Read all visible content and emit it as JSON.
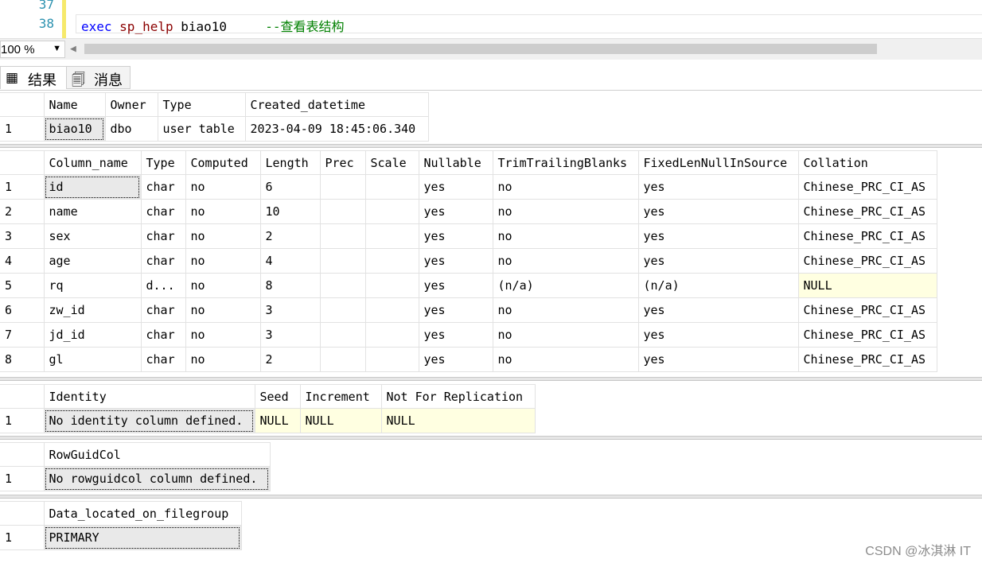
{
  "editor": {
    "line_numbers": [
      "37",
      "38"
    ],
    "code": {
      "keyword": "exec",
      "procedure": "sp_help",
      "argument": "biao10",
      "comment": "--查看表结构"
    }
  },
  "toolbar": {
    "zoom": "100 %"
  },
  "tabs": [
    {
      "label": "结果",
      "icon": "grid-icon",
      "active": true
    },
    {
      "label": "消息",
      "icon": "message-icon",
      "active": false
    }
  ],
  "results": {
    "table_info": {
      "headers": [
        "Name",
        "Owner",
        "Type",
        "Created_datetime"
      ],
      "rows": [
        {
          "n": "1",
          "cells": [
            "biao10",
            "dbo",
            "user table",
            "2023-04-09 18:45:06.340"
          ]
        }
      ]
    },
    "columns": {
      "headers": [
        "Column_name",
        "Type",
        "Computed",
        "Length",
        "Prec",
        "Scale",
        "Nullable",
        "TrimTrailingBlanks",
        "FixedLenNullInSource",
        "Collation"
      ],
      "rows": [
        {
          "n": "1",
          "cells": [
            "id",
            "char",
            "no",
            "6",
            "",
            "",
            "yes",
            "no",
            "yes",
            "Chinese_PRC_CI_AS"
          ]
        },
        {
          "n": "2",
          "cells": [
            "name",
            "char",
            "no",
            "10",
            "",
            "",
            "yes",
            "no",
            "yes",
            "Chinese_PRC_CI_AS"
          ]
        },
        {
          "n": "3",
          "cells": [
            "sex",
            "char",
            "no",
            "2",
            "",
            "",
            "yes",
            "no",
            "yes",
            "Chinese_PRC_CI_AS"
          ]
        },
        {
          "n": "4",
          "cells": [
            "age",
            "char",
            "no",
            "4",
            "",
            "",
            "yes",
            "no",
            "yes",
            "Chinese_PRC_CI_AS"
          ]
        },
        {
          "n": "5",
          "cells": [
            "rq",
            "d...",
            "no",
            "8",
            "",
            "",
            "yes",
            "(n/a)",
            "(n/a)",
            "NULL"
          ]
        },
        {
          "n": "6",
          "cells": [
            "zw_id",
            "char",
            "no",
            "3",
            "",
            "",
            "yes",
            "no",
            "yes",
            "Chinese_PRC_CI_AS"
          ]
        },
        {
          "n": "7",
          "cells": [
            "jd_id",
            "char",
            "no",
            "3",
            "",
            "",
            "yes",
            "no",
            "yes",
            "Chinese_PRC_CI_AS"
          ]
        },
        {
          "n": "8",
          "cells": [
            "gl",
            "char",
            "no",
            "2",
            "",
            "",
            "yes",
            "no",
            "yes",
            "Chinese_PRC_CI_AS"
          ]
        }
      ]
    },
    "identity": {
      "headers": [
        "Identity",
        "Seed",
        "Increment",
        "Not For Replication"
      ],
      "rows": [
        {
          "n": "1",
          "cells": [
            "No identity column defined.",
            "NULL",
            "NULL",
            "NULL"
          ]
        }
      ]
    },
    "rowguid": {
      "headers": [
        "RowGuidCol"
      ],
      "rows": [
        {
          "n": "1",
          "cells": [
            "No rowguidcol column defined."
          ]
        }
      ]
    },
    "filegroup": {
      "headers": [
        "Data_located_on_filegroup"
      ],
      "rows": [
        {
          "n": "1",
          "cells": [
            "PRIMARY"
          ]
        }
      ]
    }
  },
  "watermark": "CSDN @冰淇淋 IT",
  "colors": {
    "keyword": "#0000ff",
    "procedure": "#8b0000",
    "comment": "#008000",
    "line_number": "#2b91af",
    "null_cell": "#ffffe1"
  }
}
